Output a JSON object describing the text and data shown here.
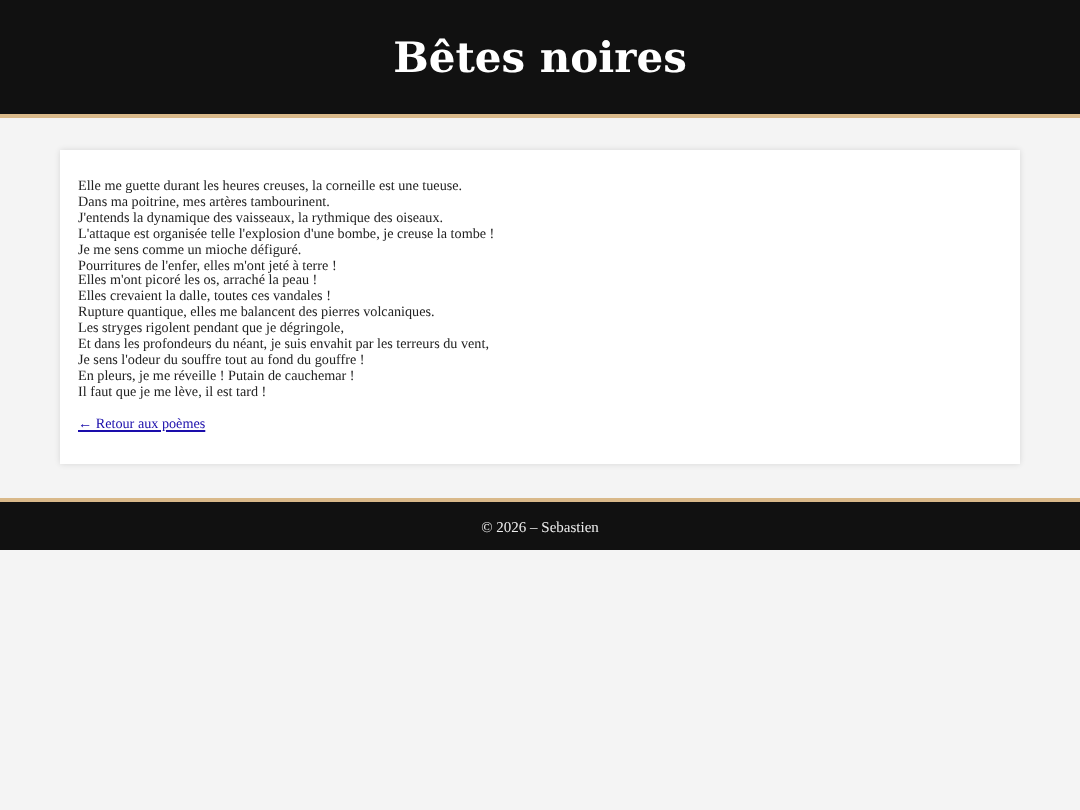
{
  "header": {
    "title": "Bêtes noires"
  },
  "poem": {
    "lines": [
      "Elle me guette durant les heures creuses, la corneille est une tueuse.",
      "Dans ma poitrine, mes artères tambourinent.",
      "J'entends la dynamique des vaisseaux, la rythmique des oiseaux.",
      "L'attaque est organisée telle l'explosion d'une bombe, je creuse la tombe !",
      "Je me sens comme un mioche défiguré.",
      "Pourritures de l'enfer, elles m'ont jeté à terre !",
      "Elles m'ont picoré les os, arraché la peau !",
      "Elles crevaient la dalle, toutes ces vandales !",
      "Rupture quantique, elles me balancent des pierres volcaniques.",
      "Les stryges rigolent pendant que je dégringole,",
      "Et dans les profondeurs du néant, je suis envahit par les terreurs du vent,",
      "Je sens l'odeur du souffre tout au fond du gouffre !",
      "En pleurs, je me réveille ! Putain de cauchemar !",
      "Il faut que je me lève, il est tard !"
    ],
    "back_link": "← Retour aux poèmes"
  },
  "footer": {
    "text": "© 2026 – Sebastien"
  }
}
